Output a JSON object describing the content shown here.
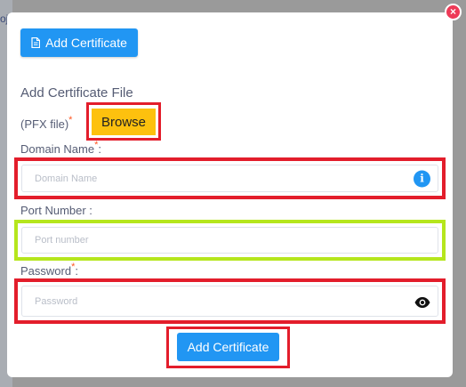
{
  "backdrop": {
    "partial_text": "oj"
  },
  "modal": {
    "close_icon": "×",
    "top_button_label": "Add Certificate",
    "section_title": "Add Certificate File",
    "pfx_label": "(PFX file)",
    "required_mark": "*",
    "browse_label": "Browse",
    "fields": {
      "domain": {
        "label": "Domain Name",
        "suffix": ":",
        "placeholder": "Domain Name",
        "value": ""
      },
      "port": {
        "label": "Port Number :",
        "placeholder": "Port number",
        "value": ""
      },
      "password": {
        "label": "Password",
        "suffix": ":",
        "placeholder": "Password",
        "value": ""
      }
    },
    "info_glyph": "i",
    "submit_label": "Add Certificate"
  },
  "colors": {
    "primary": "#2196f3",
    "browse": "#fdc10e",
    "highlight_red": "#e31d2b",
    "highlight_green": "#b5e61d",
    "close": "#ee3a57"
  },
  "icons": [
    "document-icon",
    "close-icon",
    "info-icon",
    "eye-icon"
  ]
}
